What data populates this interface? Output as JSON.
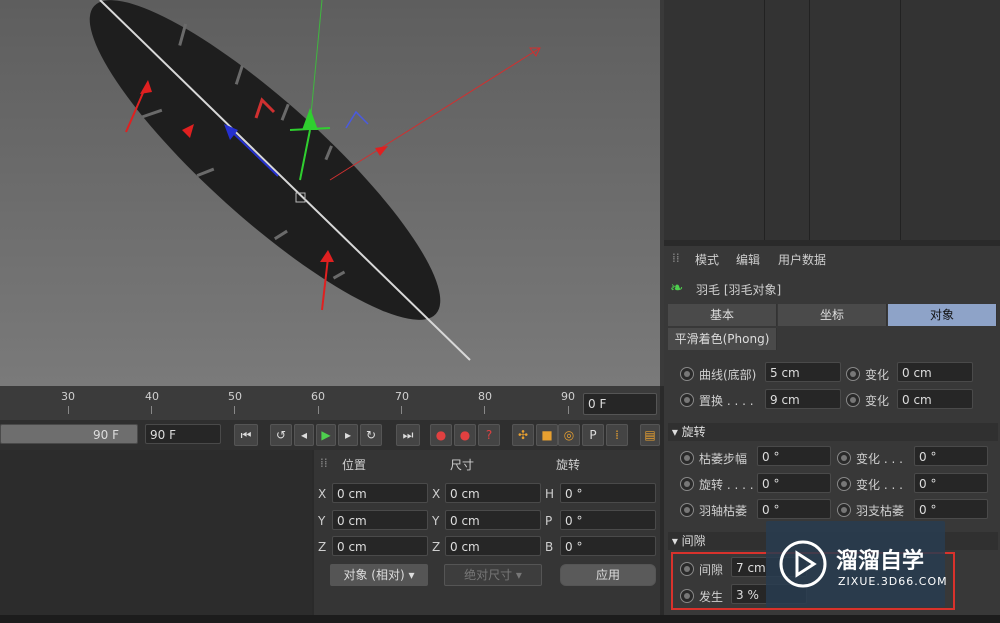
{
  "timeline": {
    "ticks": [
      "30",
      "40",
      "50",
      "60",
      "70",
      "80",
      "90"
    ],
    "frame_value": "0 F",
    "end_frame_slider": "90 F",
    "end_frame_field": "90 F"
  },
  "coords": {
    "col_position": "位置",
    "col_size": "尺寸",
    "col_rotation": "旋转",
    "rows": [
      {
        "axis": "X",
        "pos": "0 cm",
        "size_axis": "X",
        "size": "0 cm",
        "rot_axis": "H",
        "rot": "0 °"
      },
      {
        "axis": "Y",
        "pos": "0 cm",
        "size_axis": "Y",
        "size": "0 cm",
        "rot_axis": "P",
        "rot": "0 °"
      },
      {
        "axis": "Z",
        "pos": "0 cm",
        "size_axis": "Z",
        "size": "0 cm",
        "rot_axis": "B",
        "rot": "0 °"
      }
    ],
    "mode_select": "对象 (相对)",
    "size_select": "绝对尺寸",
    "apply_label": "应用"
  },
  "attr": {
    "menu": [
      "模式",
      "编辑",
      "用户数据"
    ],
    "object_title": "羽毛 [羽毛对象]",
    "tabs": [
      "基本",
      "坐标",
      "对象"
    ],
    "subtab": "平滑着色(Phong)",
    "rows_top": [
      {
        "label": "曲线(底部)",
        "value": "5 cm",
        "label2": "变化",
        "value2": "0 cm"
      },
      {
        "label": "置换 . . . .",
        "value": "9 cm",
        "label2": "变化",
        "value2": "0 cm"
      }
    ],
    "section_rotation": "旋转",
    "rows_rot": [
      {
        "label": "枯萎步幅",
        "value": "0 °",
        "label2": "变化 . . .",
        "value2": "0 °"
      },
      {
        "label": "旋转 . . . .",
        "value": "0 °",
        "label2": "变化 . . .",
        "value2": "0 °"
      },
      {
        "label": "羽轴枯萎",
        "value": "0 °",
        "label2": "羽支枯萎",
        "value2": "0 °"
      }
    ],
    "section_gap": "间隙",
    "rows_gap": [
      {
        "label": "间隙",
        "value": "7 cm"
      },
      {
        "label": "发生",
        "value": "3 %"
      }
    ]
  },
  "watermark": {
    "title": "溜溜自学",
    "url": "ZIXUE.3D66.COM"
  },
  "colors": {
    "active_tab": "#8ea3c8",
    "highlight": "#d9322c",
    "feather": "#1e1e1e"
  }
}
